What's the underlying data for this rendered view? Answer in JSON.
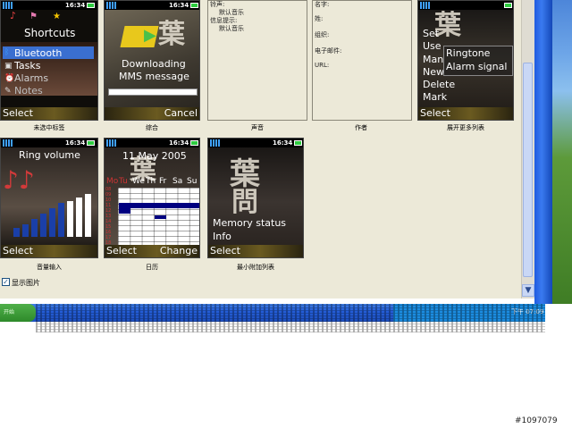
{
  "tiles": {
    "shortcuts": {
      "caption": "未选中标签",
      "time": "16:34",
      "title": "Shortcuts",
      "items": [
        "Bluetooth",
        "Tasks",
        "Alarms",
        "Notes"
      ],
      "left_soft": "Select"
    },
    "downloading": {
      "caption": "综合",
      "time": "16:34",
      "title_line1": "Downloading",
      "title_line2": "MMS message",
      "right_soft": "Cancel",
      "progress": 0.0
    },
    "more_list": {
      "caption": "展开更多列表",
      "time": "16:34",
      "items": [
        "Set",
        "Use",
        "Man",
        "New",
        "Delete",
        "Mark"
      ],
      "popup": [
        "Ringtone",
        "Alarm signal"
      ],
      "left_soft": "Select"
    },
    "ring_volume": {
      "caption": "音量输入",
      "time": "16:34",
      "title": "Ring volume",
      "left_soft": "Select"
    },
    "calendar": {
      "caption": "日历",
      "time": "16:34",
      "title": "11 May 2005",
      "weekdays": [
        "Mo",
        "Tu",
        "We",
        "Th",
        "Fr",
        "Sa",
        "Su"
      ],
      "hours": [
        "08",
        "09",
        "10",
        "11",
        "12",
        "13",
        "14",
        "15",
        "16",
        "17",
        "18"
      ],
      "left_soft": "Select",
      "right_soft": "Change"
    },
    "memory": {
      "caption": "最小附加列表",
      "time": "16:34",
      "items": [
        "Memory status",
        "Info"
      ],
      "left_soft": "Select"
    }
  },
  "panels": {
    "sound": {
      "caption": "声音",
      "lines": [
        "铃声:",
        "默认音乐",
        "信息提示:",
        "默认音乐"
      ]
    },
    "author": {
      "caption": "作者",
      "lines": [
        "名字:",
        "姓:",
        "组织:",
        "电子邮件:",
        "URL:"
      ]
    }
  },
  "checkbox": {
    "label": "显示图片",
    "checked": true
  },
  "taskbar": {
    "start_label": "开始",
    "clock": "下午 07:09"
  },
  "watermark": "#1097079",
  "colors": {
    "calendar_event": "#000080",
    "equalizer_bar": "#1a3fa8",
    "heart": "#d23a3a",
    "highlight": "#3a6fd0"
  }
}
